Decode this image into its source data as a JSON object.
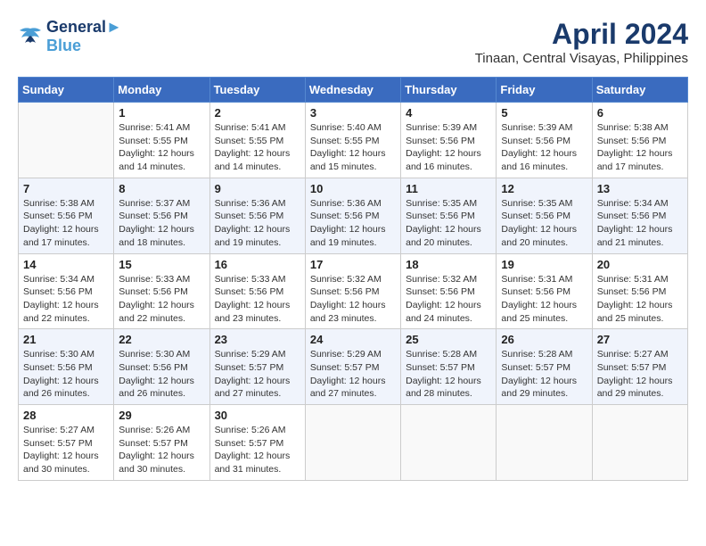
{
  "logo": {
    "line1": "General",
    "line2": "Blue"
  },
  "title": "April 2024",
  "subtitle": "Tinaan, Central Visayas, Philippines",
  "weekdays": [
    "Sunday",
    "Monday",
    "Tuesday",
    "Wednesday",
    "Thursday",
    "Friday",
    "Saturday"
  ],
  "weeks": [
    [
      null,
      {
        "day": 1,
        "sunrise": "5:41 AM",
        "sunset": "5:55 PM",
        "daylight": "12 hours and 14 minutes."
      },
      {
        "day": 2,
        "sunrise": "5:41 AM",
        "sunset": "5:55 PM",
        "daylight": "12 hours and 14 minutes."
      },
      {
        "day": 3,
        "sunrise": "5:40 AM",
        "sunset": "5:55 PM",
        "daylight": "12 hours and 15 minutes."
      },
      {
        "day": 4,
        "sunrise": "5:39 AM",
        "sunset": "5:56 PM",
        "daylight": "12 hours and 16 minutes."
      },
      {
        "day": 5,
        "sunrise": "5:39 AM",
        "sunset": "5:56 PM",
        "daylight": "12 hours and 16 minutes."
      },
      {
        "day": 6,
        "sunrise": "5:38 AM",
        "sunset": "5:56 PM",
        "daylight": "12 hours and 17 minutes."
      }
    ],
    [
      {
        "day": 7,
        "sunrise": "5:38 AM",
        "sunset": "5:56 PM",
        "daylight": "12 hours and 17 minutes."
      },
      {
        "day": 8,
        "sunrise": "5:37 AM",
        "sunset": "5:56 PM",
        "daylight": "12 hours and 18 minutes."
      },
      {
        "day": 9,
        "sunrise": "5:36 AM",
        "sunset": "5:56 PM",
        "daylight": "12 hours and 19 minutes."
      },
      {
        "day": 10,
        "sunrise": "5:36 AM",
        "sunset": "5:56 PM",
        "daylight": "12 hours and 19 minutes."
      },
      {
        "day": 11,
        "sunrise": "5:35 AM",
        "sunset": "5:56 PM",
        "daylight": "12 hours and 20 minutes."
      },
      {
        "day": 12,
        "sunrise": "5:35 AM",
        "sunset": "5:56 PM",
        "daylight": "12 hours and 20 minutes."
      },
      {
        "day": 13,
        "sunrise": "5:34 AM",
        "sunset": "5:56 PM",
        "daylight": "12 hours and 21 minutes."
      }
    ],
    [
      {
        "day": 14,
        "sunrise": "5:34 AM",
        "sunset": "5:56 PM",
        "daylight": "12 hours and 22 minutes."
      },
      {
        "day": 15,
        "sunrise": "5:33 AM",
        "sunset": "5:56 PM",
        "daylight": "12 hours and 22 minutes."
      },
      {
        "day": 16,
        "sunrise": "5:33 AM",
        "sunset": "5:56 PM",
        "daylight": "12 hours and 23 minutes."
      },
      {
        "day": 17,
        "sunrise": "5:32 AM",
        "sunset": "5:56 PM",
        "daylight": "12 hours and 23 minutes."
      },
      {
        "day": 18,
        "sunrise": "5:32 AM",
        "sunset": "5:56 PM",
        "daylight": "12 hours and 24 minutes."
      },
      {
        "day": 19,
        "sunrise": "5:31 AM",
        "sunset": "5:56 PM",
        "daylight": "12 hours and 25 minutes."
      },
      {
        "day": 20,
        "sunrise": "5:31 AM",
        "sunset": "5:56 PM",
        "daylight": "12 hours and 25 minutes."
      }
    ],
    [
      {
        "day": 21,
        "sunrise": "5:30 AM",
        "sunset": "5:56 PM",
        "daylight": "12 hours and 26 minutes."
      },
      {
        "day": 22,
        "sunrise": "5:30 AM",
        "sunset": "5:56 PM",
        "daylight": "12 hours and 26 minutes."
      },
      {
        "day": 23,
        "sunrise": "5:29 AM",
        "sunset": "5:57 PM",
        "daylight": "12 hours and 27 minutes."
      },
      {
        "day": 24,
        "sunrise": "5:29 AM",
        "sunset": "5:57 PM",
        "daylight": "12 hours and 27 minutes."
      },
      {
        "day": 25,
        "sunrise": "5:28 AM",
        "sunset": "5:57 PM",
        "daylight": "12 hours and 28 minutes."
      },
      {
        "day": 26,
        "sunrise": "5:28 AM",
        "sunset": "5:57 PM",
        "daylight": "12 hours and 29 minutes."
      },
      {
        "day": 27,
        "sunrise": "5:27 AM",
        "sunset": "5:57 PM",
        "daylight": "12 hours and 29 minutes."
      }
    ],
    [
      {
        "day": 28,
        "sunrise": "5:27 AM",
        "sunset": "5:57 PM",
        "daylight": "12 hours and 30 minutes."
      },
      {
        "day": 29,
        "sunrise": "5:26 AM",
        "sunset": "5:57 PM",
        "daylight": "12 hours and 30 minutes."
      },
      {
        "day": 30,
        "sunrise": "5:26 AM",
        "sunset": "5:57 PM",
        "daylight": "12 hours and 31 minutes."
      },
      null,
      null,
      null,
      null
    ]
  ]
}
